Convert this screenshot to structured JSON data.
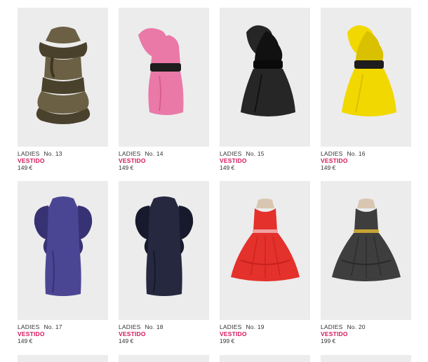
{
  "products": [
    {
      "category": "LADIES",
      "number": "No. 13",
      "type": "VESTIDO",
      "price": "149 €",
      "colors": {
        "main": "#6b6044",
        "accent": "#4a412c",
        "belt": "#3e3624"
      }
    },
    {
      "category": "LADIES",
      "number": "No. 14",
      "type": "VESTIDO",
      "price": "149 €",
      "colors": {
        "main": "#ea79a8",
        "accent": "#d85d90",
        "belt": "#1d1d1d"
      }
    },
    {
      "category": "LADIES",
      "number": "No. 15",
      "type": "VESTIDO",
      "price": "149 €",
      "colors": {
        "main": "#262626",
        "accent": "#111111",
        "belt": "#0a0a0a"
      }
    },
    {
      "category": "LADIES",
      "number": "No. 16",
      "type": "VESTIDO",
      "price": "149 €",
      "colors": {
        "main": "#f1d800",
        "accent": "#d9c100",
        "belt": "#1d1d1d"
      }
    },
    {
      "category": "LADIES",
      "number": "No. 17",
      "type": "VESTIDO",
      "price": "149 €",
      "colors": {
        "main": "#4b4694",
        "accent": "#363274",
        "belt": "#3b377d"
      }
    },
    {
      "category": "LADIES",
      "number": "No. 18",
      "type": "VESTIDO",
      "price": "149 €",
      "colors": {
        "main": "#25283f",
        "accent": "#171a2c",
        "belt": "#1c1f33"
      }
    },
    {
      "category": "LADIES",
      "number": "No. 19",
      "type": "VESTIDO",
      "price": "199 €",
      "colors": {
        "main": "#e4312b",
        "accent": "#c7221e",
        "belt": "#f0a0a0"
      }
    },
    {
      "category": "LADIES",
      "number": "No. 20",
      "type": "VESTIDO",
      "price": "199 €",
      "colors": {
        "main": "#3e3e3e",
        "accent": "#2a2a2a",
        "belt": "#c7a434"
      }
    }
  ]
}
